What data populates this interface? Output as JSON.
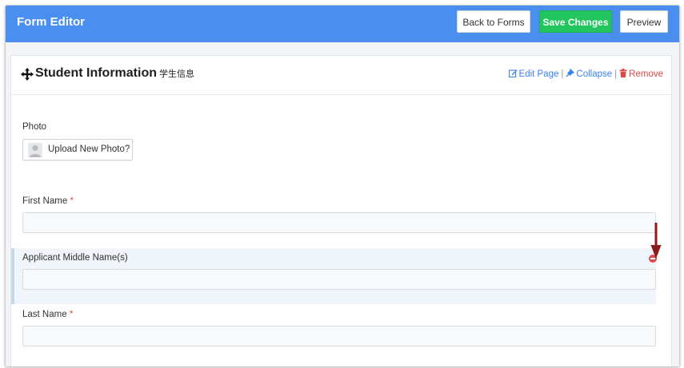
{
  "app": {
    "title": "Form Editor"
  },
  "toolbar": {
    "back_label": "Back to Forms",
    "save_label": "Save Changes",
    "preview_label": "Preview"
  },
  "section": {
    "title": "Student Information",
    "subtitle": "学生信息",
    "actions": {
      "edit_label": "Edit Page",
      "separator": "|",
      "collapse_label": "Collapse",
      "remove_label": "Remove"
    }
  },
  "fields": {
    "photo": {
      "label": "Photo",
      "upload_label": "Upload New Photo?"
    },
    "first_name": {
      "label": "First Name",
      "required_mark": "*",
      "value": ""
    },
    "middle_name": {
      "label": "Applicant Middle Name(s)",
      "value": ""
    },
    "last_name": {
      "label": "Last Name",
      "required_mark": "*",
      "value": ""
    }
  },
  "icons": {
    "move": "move-icon",
    "edit": "edit-icon",
    "collapse": "collapse-icon",
    "trash": "trash-icon",
    "avatar": "avatar-icon",
    "remove_field": "remove-circle-icon",
    "annotation": "annotation-arrow-icon"
  },
  "colors": {
    "topbar": "#4a8ff0",
    "success": "#22c55e",
    "link": "#3b82f6",
    "danger": "#e04848",
    "arrow": "#8b1a1a"
  }
}
